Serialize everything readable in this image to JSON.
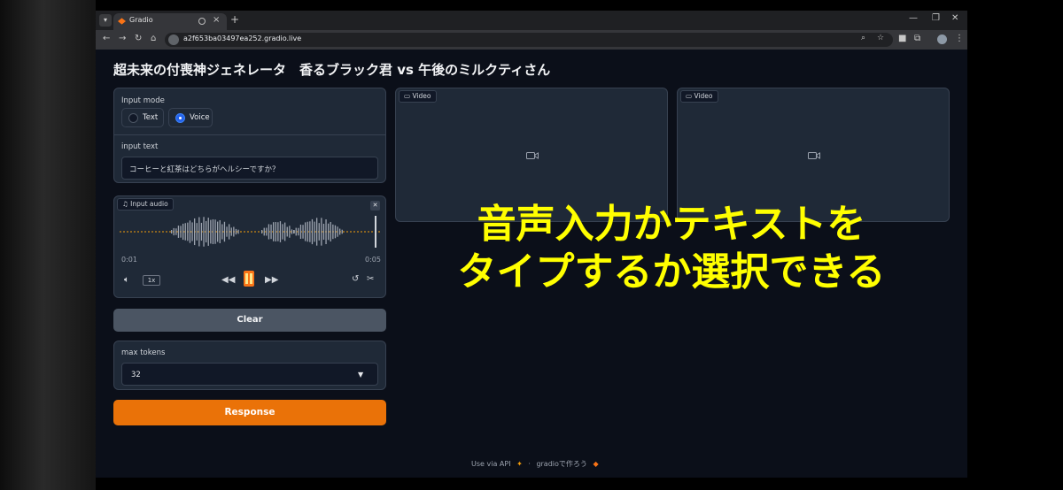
{
  "browser": {
    "tab_title": "Gradio",
    "new_tab_symbol": "+",
    "url": "a2f653ba03497ea252.gradio.live"
  },
  "page": {
    "title": "超未来の付喪神ジェネレータ　香るブラック君 vs 午後のミルクティさん"
  },
  "input_mode": {
    "label": "Input mode",
    "options": [
      "Text",
      "Voice"
    ],
    "selected": "Voice"
  },
  "input_text": {
    "label": "input text",
    "value": "コーヒーと紅茶はどちらがヘルシーですか？"
  },
  "input_audio": {
    "label": "Input audio",
    "current_time": "0:01",
    "duration": "0:05",
    "speed": "1x"
  },
  "clear_button": {
    "label": "Clear"
  },
  "max_tokens": {
    "label": "max tokens",
    "value": "32"
  },
  "response_button": {
    "label": "Response"
  },
  "videos": [
    {
      "label": "Video"
    },
    {
      "label": "Video"
    }
  ],
  "overlay_caption": {
    "line1": "音声入力かテキストを",
    "line2": "タイプするか選択できる"
  },
  "footer": {
    "api_link": "Use via API",
    "separator": "·",
    "built_with": "gradioで作ろう"
  },
  "colors": {
    "accent_orange": "#ea7208",
    "selected_radio": "#2563eb",
    "overlay_text": "#ffff00",
    "page_background": "#0b0f19",
    "panel_background": "#1f2937"
  },
  "icons": [
    "chevron-down-icon",
    "gradio-logo-icon",
    "speaker-icon",
    "close-icon",
    "back-icon",
    "forward-icon",
    "reload-icon",
    "home-icon",
    "site-info-icon",
    "zoom-icon",
    "star-icon",
    "extension-icon",
    "music-icon",
    "volume-icon",
    "rewind-icon",
    "pause-icon",
    "fast-forward-icon",
    "undo-icon",
    "scissors-icon",
    "caret-down-icon",
    "video-camera-icon"
  ]
}
